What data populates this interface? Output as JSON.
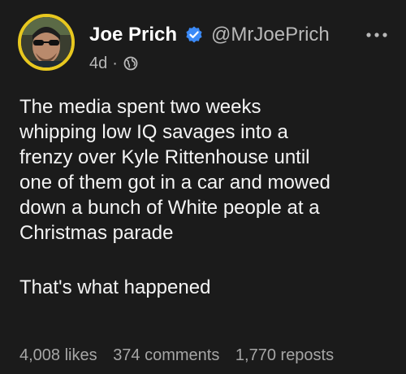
{
  "author": {
    "display_name": "Joe Prich",
    "handle": "@MrJoePrich",
    "verified": true,
    "avatar_ring_color": "#e8c81f",
    "verified_color": "#3b8af7"
  },
  "meta": {
    "age": "4d",
    "separator": "·",
    "visibility_icon": "globe-icon"
  },
  "post": {
    "lines": [
      "The media spent two weeks",
      "whipping low IQ savages into a",
      "frenzy over Kyle Rittenhouse until",
      "one of them got in a car and mowed",
      "down a bunch of White people at a",
      "Christmas parade"
    ],
    "closing_line": "That's what happened"
  },
  "stats": {
    "likes": "4,008 likes",
    "comments": "374 comments",
    "reposts": "1,770 reposts"
  },
  "icons": {
    "more": "more-options-icon",
    "verified": "verified-badge-icon"
  }
}
